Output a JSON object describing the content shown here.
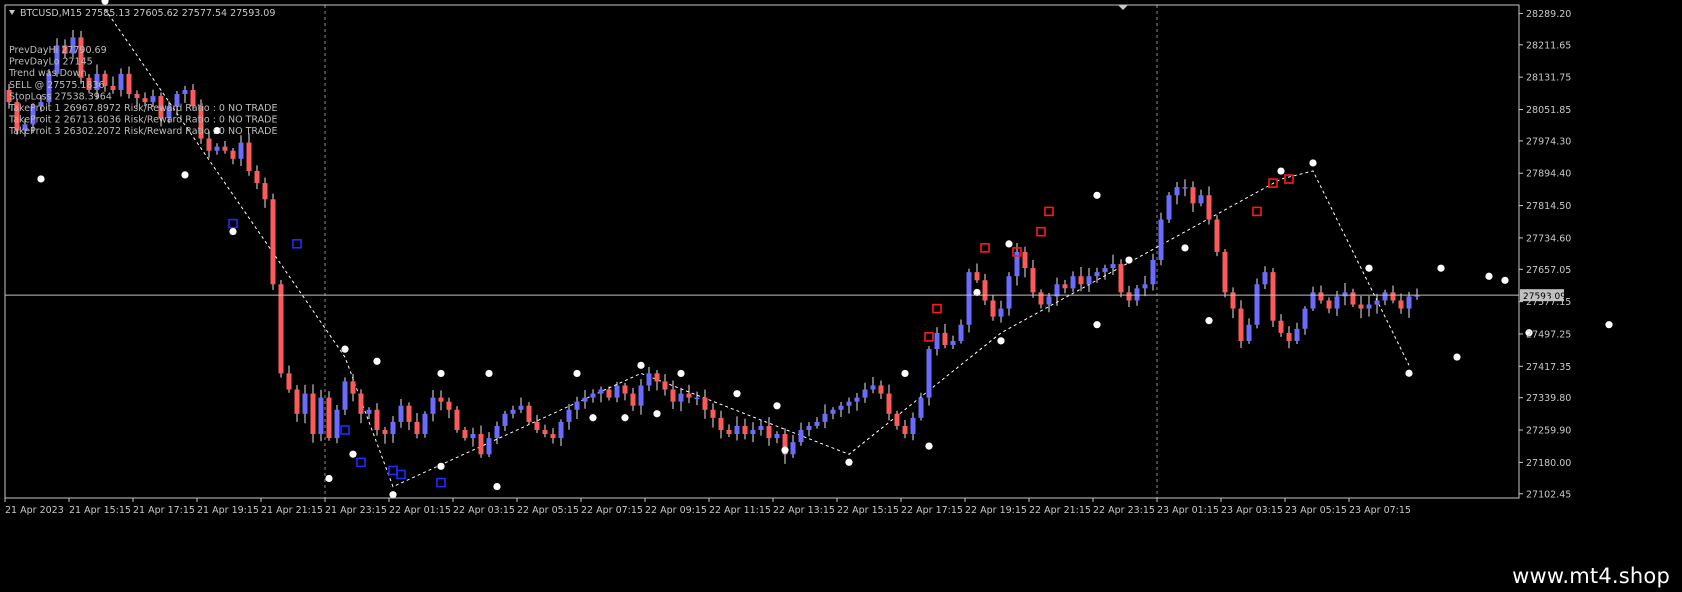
{
  "header": {
    "symbol_line": "BTCUSD,M15  27585.13 27605.62 27577.54 27593.09"
  },
  "info_panel": {
    "lines": [
      "PrevDayHi 27790.69",
      "PrevDayLo 27145",
      "Trend was Down",
      "SELL @ 27575.1836",
      "StopLoss 27538.3964",
      "TakeProit 1 26967.8972 Risk/Reward Ratio : 0 NO TRADE",
      "TakeProit 2 26713.6036 Risk/Reward Ratio : 0 NO TRADE",
      "TakeProit 3 26302.2072 Risk/Reward Ratio : 0 NO TRADE"
    ]
  },
  "footer": {
    "site": "www.mt4.shop"
  },
  "colors": {
    "background": "#000000",
    "bull": "#6b6bff",
    "bear": "#ff5a5a",
    "grid": "#c8c8c8",
    "axis_text": "#c8c8c8",
    "price_line": "#c0c0c0",
    "zigzag": "#ffffff",
    "swing_dot": "#ffffff",
    "support_marker": "#1e2cff",
    "resistance_marker": "#ff1a1a"
  },
  "chart_data": {
    "type": "candlestick",
    "symbol": "BTCUSD",
    "timeframe": "M15",
    "ohlc_header": {
      "open": 27585.13,
      "high": 27605.62,
      "low": 27577.54,
      "close": 27593.09
    },
    "current_price": 27593.09,
    "y_ticks": [
      28289.2,
      28211.65,
      28131.75,
      28051.85,
      27974.3,
      27894.4,
      27814.5,
      27734.6,
      27657.05,
      27577.15,
      27497.25,
      27417.35,
      27339.8,
      27259.9,
      27180.0,
      27102.45
    ],
    "ylim": [
      27092.0,
      28310.0
    ],
    "x_labels": [
      "21 Apr 2023",
      "21 Apr 15:15",
      "21 Apr 17:15",
      "21 Apr 19:15",
      "21 Apr 21:15",
      "21 Apr 23:15",
      "22 Apr 01:15",
      "22 Apr 03:15",
      "22 Apr 05:15",
      "22 Apr 07:15",
      "22 Apr 09:15",
      "22 Apr 11:15",
      "22 Apr 13:15",
      "22 Apr 15:15",
      "22 Apr 17:15",
      "22 Apr 19:15",
      "22 Apr 21:15",
      "22 Apr 23:15",
      "23 Apr 01:15",
      "23 Apr 03:15",
      "23 Apr 05:15",
      "23 Apr 07:15"
    ],
    "bars_per_label": 8,
    "period_separators_after_label": [
      "21 Apr 21:15",
      "22 Apr 23:15"
    ],
    "closes": [
      28070,
      28000,
      28015,
      28060,
      28070,
      28140,
      28210,
      28190,
      28230,
      28130,
      28100,
      28140,
      28110,
      28100,
      28140,
      28090,
      28080,
      28070,
      28085,
      28030,
      28060,
      28090,
      28100,
      28060,
      27980,
      27950,
      27960,
      27950,
      27930,
      27970,
      27900,
      27870,
      27830,
      27620,
      27400,
      27360,
      27300,
      27350,
      27250,
      27340,
      27240,
      27310,
      27380,
      27350,
      27300,
      27310,
      27260,
      27250,
      27280,
      27320,
      27280,
      27250,
      27300,
      27340,
      27330,
      27310,
      27260,
      27240,
      27250,
      27200,
      27240,
      27270,
      27300,
      27310,
      27320,
      27280,
      27260,
      27250,
      27240,
      27280,
      27310,
      27330,
      27340,
      27350,
      27360,
      27340,
      27370,
      27350,
      27320,
      27370,
      27400,
      27380,
      27360,
      27330,
      27350,
      27340,
      27340,
      27310,
      27290,
      27260,
      27250,
      27270,
      27250,
      27260,
      27270,
      27240,
      27250,
      27200,
      27230,
      27260,
      27270,
      27280,
      27300,
      27310,
      27320,
      27330,
      27340,
      27360,
      27370,
      27350,
      27300,
      27270,
      27250,
      27290,
      27340,
      27460,
      27500,
      27470,
      27480,
      27520,
      27650,
      27630,
      27580,
      27540,
      27560,
      27640,
      27700,
      27660,
      27600,
      27570,
      27590,
      27620,
      27610,
      27640,
      27620,
      27640,
      27650,
      27660,
      27670,
      27600,
      27580,
      27610,
      27620,
      27680,
      27780,
      27840,
      27860,
      27860,
      27820,
      27840,
      27780,
      27700,
      27600,
      27560,
      27480,
      27520,
      27620,
      27650,
      27530,
      27500,
      27480,
      27510,
      27560,
      27600,
      27580,
      27560,
      27590,
      27600,
      27570,
      27560,
      27570,
      27580,
      27600,
      27580,
      27560,
      27590,
      27593
    ],
    "swing_highs": [
      [
        12,
        28300
      ],
      [
        26,
        27980
      ],
      [
        42,
        27440
      ],
      [
        46,
        27410
      ],
      [
        54,
        27380
      ],
      [
        60,
        27380
      ],
      [
        71,
        27380
      ],
      [
        79,
        27400
      ],
      [
        84,
        27380
      ],
      [
        91,
        27330
      ],
      [
        96,
        27300
      ],
      [
        112,
        27380
      ],
      [
        121,
        27580
      ],
      [
        125,
        27700
      ],
      [
        136,
        27820
      ],
      [
        140,
        27660
      ],
      [
        147,
        27690
      ],
      [
        159,
        27880
      ],
      [
        163,
        27900
      ],
      [
        170,
        27640
      ],
      [
        179,
        27640
      ],
      [
        185,
        27620
      ],
      [
        187,
        27610
      ]
    ],
    "swing_lows": [
      [
        4,
        27900
      ],
      [
        22,
        27910
      ],
      [
        28,
        27770
      ],
      [
        40,
        27160
      ],
      [
        43,
        27220
      ],
      [
        48,
        27120
      ],
      [
        54,
        27190
      ],
      [
        61,
        27140
      ],
      [
        73,
        27310
      ],
      [
        77,
        27310
      ],
      [
        81,
        27320
      ],
      [
        97,
        27230
      ],
      [
        105,
        27200
      ],
      [
        115,
        27240
      ],
      [
        124,
        27500
      ],
      [
        136,
        27540
      ],
      [
        150,
        27550
      ],
      [
        175,
        27420
      ],
      [
        181,
        27460
      ],
      [
        190,
        27520
      ],
      [
        200,
        27540
      ]
    ],
    "zigzag": [
      [
        12,
        28300
      ],
      [
        42,
        27440
      ],
      [
        48,
        27120
      ],
      [
        79,
        27400
      ],
      [
        105,
        27200
      ],
      [
        124,
        27500
      ],
      [
        159,
        27880
      ],
      [
        163,
        27900
      ],
      [
        175,
        27420
      ]
    ],
    "resistance_markers": [
      [
        115,
        27490
      ],
      [
        116,
        27560
      ],
      [
        122,
        27710
      ],
      [
        126,
        27700
      ],
      [
        129,
        27750
      ],
      [
        130,
        27800
      ],
      [
        156,
        27800
      ],
      [
        158,
        27870
      ],
      [
        160,
        27880
      ]
    ],
    "support_markers": [
      [
        28,
        27770
      ],
      [
        36,
        27720
      ],
      [
        42,
        27260
      ],
      [
        44,
        27180
      ],
      [
        48,
        27160
      ],
      [
        49,
        27150
      ],
      [
        54,
        27130
      ]
    ]
  }
}
